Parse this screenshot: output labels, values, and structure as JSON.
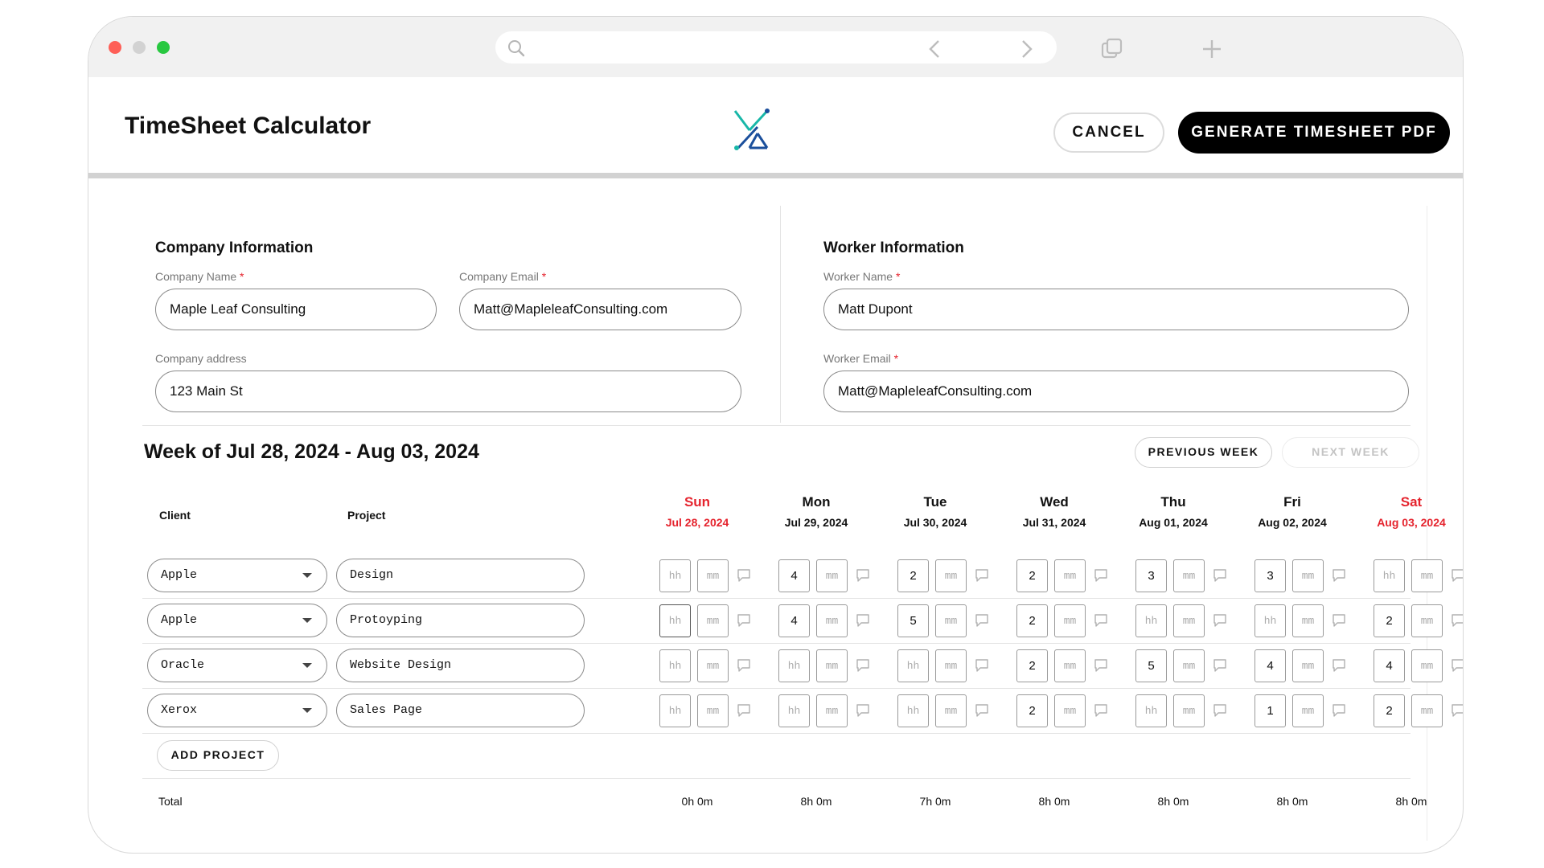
{
  "app": {
    "title": "TimeSheet Calculator",
    "cancel_label": "CANCEL",
    "generate_label": "GENERATE TIMESHEET PDF"
  },
  "company": {
    "section_title": "Company Information",
    "name_label": "Company Name",
    "name_value": "Maple Leaf Consulting",
    "email_label": "Company Email",
    "email_value": "Matt@MapleleafConsulting.com",
    "address_label": "Company address",
    "address_value": "123 Main St"
  },
  "worker": {
    "section_title": "Worker Information",
    "name_label": "Worker Name",
    "name_value": "Matt Dupont",
    "email_label": "Worker Email",
    "email_value": "Matt@MapleleafConsulting.com"
  },
  "required_mark": "*",
  "week": {
    "title": "Week of Jul 28, 2024 - Aug 03, 2024",
    "prev_label": "PREVIOUS WEEK",
    "next_label": "NEXT WEEK"
  },
  "table": {
    "client_header": "Client",
    "project_header": "Project",
    "placeholder_hh": "hh",
    "placeholder_mm": "mm",
    "days": [
      {
        "name": "Sun",
        "date": "Jul 28, 2024",
        "weekend": true
      },
      {
        "name": "Mon",
        "date": "Jul 29, 2024",
        "weekend": false
      },
      {
        "name": "Tue",
        "date": "Jul 30, 2024",
        "weekend": false
      },
      {
        "name": "Wed",
        "date": "Jul 31, 2024",
        "weekend": false
      },
      {
        "name": "Thu",
        "date": "Aug 01, 2024",
        "weekend": false
      },
      {
        "name": "Fri",
        "date": "Aug 02, 2024",
        "weekend": false
      },
      {
        "name": "Sat",
        "date": "Aug 03, 2024",
        "weekend": true
      }
    ],
    "rows": [
      {
        "client": "Apple",
        "project": "Design",
        "hours": [
          "",
          "4",
          "2",
          "2",
          "3",
          "3",
          ""
        ]
      },
      {
        "client": "Apple",
        "project": "Protoyping",
        "hours": [
          "",
          "4",
          "5",
          "2",
          "",
          "",
          "2"
        ]
      },
      {
        "client": "Oracle",
        "project": "Website Design",
        "hours": [
          "",
          "",
          "",
          "2",
          "5",
          "4",
          "4"
        ]
      },
      {
        "client": "Xerox",
        "project": "Sales Page",
        "hours": [
          "",
          "",
          "",
          "2",
          "",
          "1",
          "2"
        ]
      }
    ],
    "add_project_label": "ADD PROJECT",
    "total_label": "Total",
    "totals": [
      "0h 0m",
      "8h 0m",
      "7h 0m",
      "8h 0m",
      "8h 0m",
      "8h 0m",
      "8h 0m"
    ]
  },
  "icons": {
    "search": "search-icon",
    "back": "chevron-left-icon",
    "forward": "chevron-right-icon",
    "tabs": "tabs-icon",
    "new_tab": "plus-icon",
    "comment": "comment-icon",
    "dropdown": "caret-down-icon",
    "logo": "logo-icon"
  },
  "colors": {
    "accent": "#000000",
    "weekend": "#e5232d",
    "logo_teal": "#18b7a8",
    "logo_blue": "#1b4f9c"
  }
}
